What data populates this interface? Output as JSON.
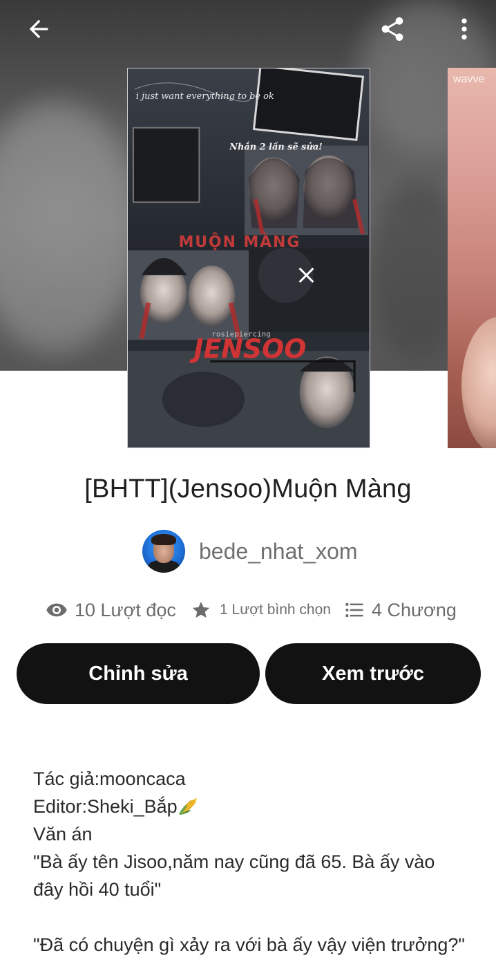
{
  "icons": {
    "back": "arrow-back-icon",
    "share": "share-icon",
    "more": "more-vertical-icon",
    "reads": "eye-icon",
    "votes": "star-icon",
    "parts": "list-icon"
  },
  "colors": {
    "button_bg": "#121212",
    "button_text": "#ffffff",
    "muted_text": "#6c6c6c"
  },
  "story": {
    "title": "[BHTT](Jensoo)Muộn Màng",
    "cover_text": {
      "top": "i just want everything to be ok",
      "mid": "Nhắn 2 lần sẽ sửa!",
      "title": "MUỘN MÀNG",
      "credit": "rosiepiercing",
      "name": "JENSOO"
    },
    "next_cover_tag": "wavve",
    "author": {
      "name": "bede_nhat_xom"
    },
    "stats": {
      "reads": "10 Lượt đọc",
      "votes": "1 Lượt bình chọn",
      "parts": "4 Chương"
    }
  },
  "actions": {
    "edit_label": "Chỉnh sửa",
    "preview_label": "Xem trước"
  },
  "description": {
    "line1": "Tác giả:mooncaca",
    "line2": "Editor:Sheki_Bắp",
    "line3": "Văn án",
    "line4": "\"Bà ấy tên Jisoo,năm nay cũng đã 65. Bà ấy vào",
    "line5": "đây hồi 40 tuổi\"",
    "line6": "\"Đã có chuyện gì xảy ra với bà ấy vậy viện trưởng?\""
  }
}
